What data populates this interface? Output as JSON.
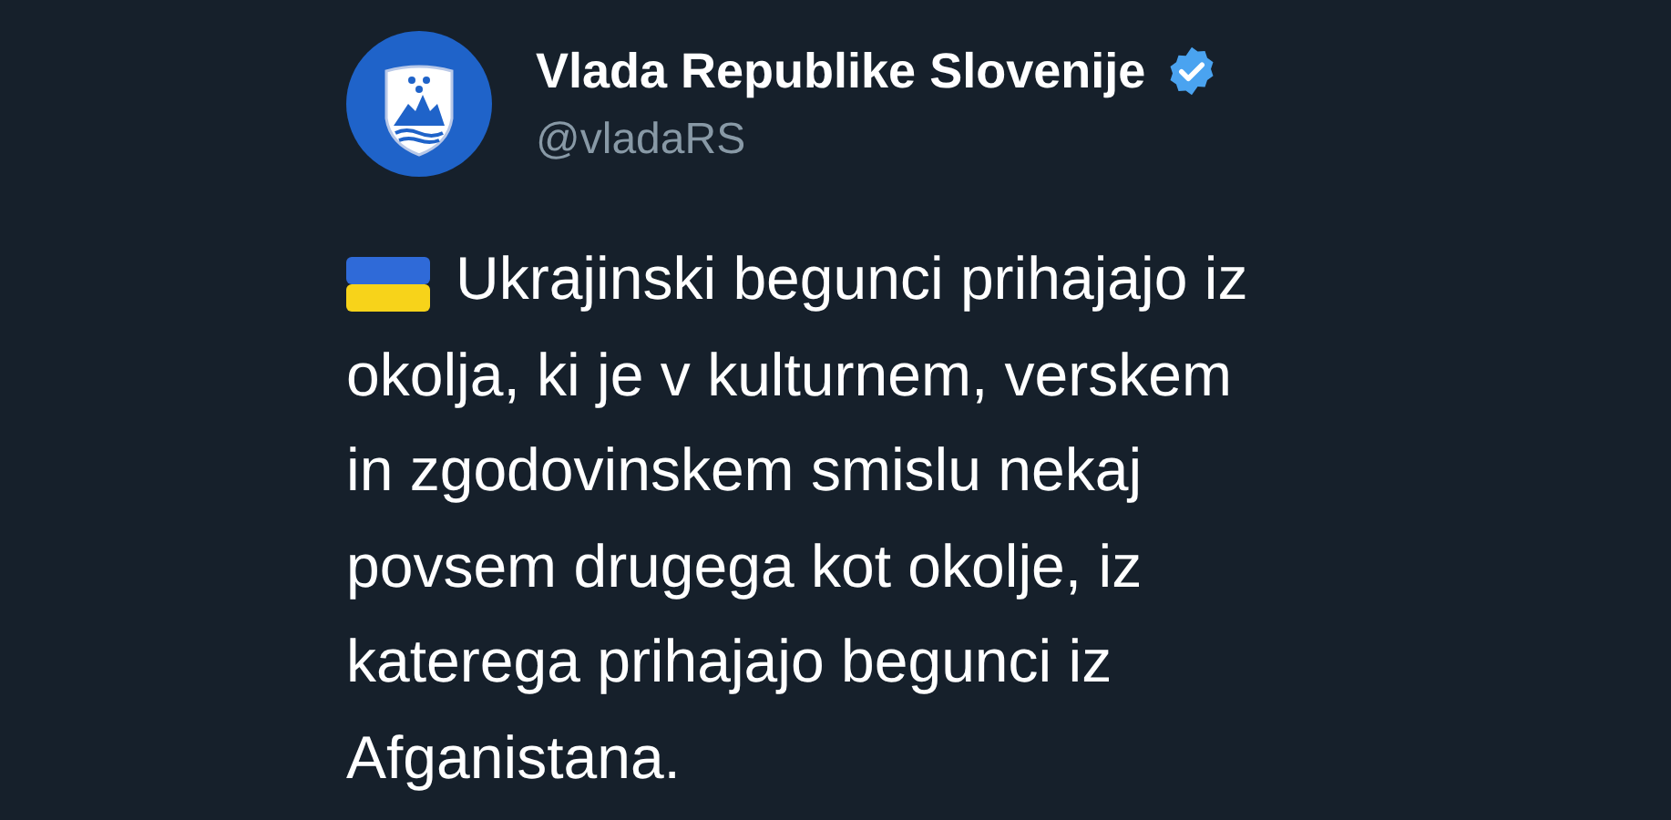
{
  "author": {
    "name": "Vlada Republike Slovenije",
    "verified": true,
    "handle": "@vladaRS"
  },
  "tweet": {
    "lines": [
      "Ukrajinski begunci prihajajo iz",
      "okolja, ki je v kulturnem, verskem",
      "in zgodovinskem smislu nekaj",
      "povsem drugega kot okolje, iz",
      "katerega prihajajo begunci iz",
      "Afganistana."
    ]
  }
}
